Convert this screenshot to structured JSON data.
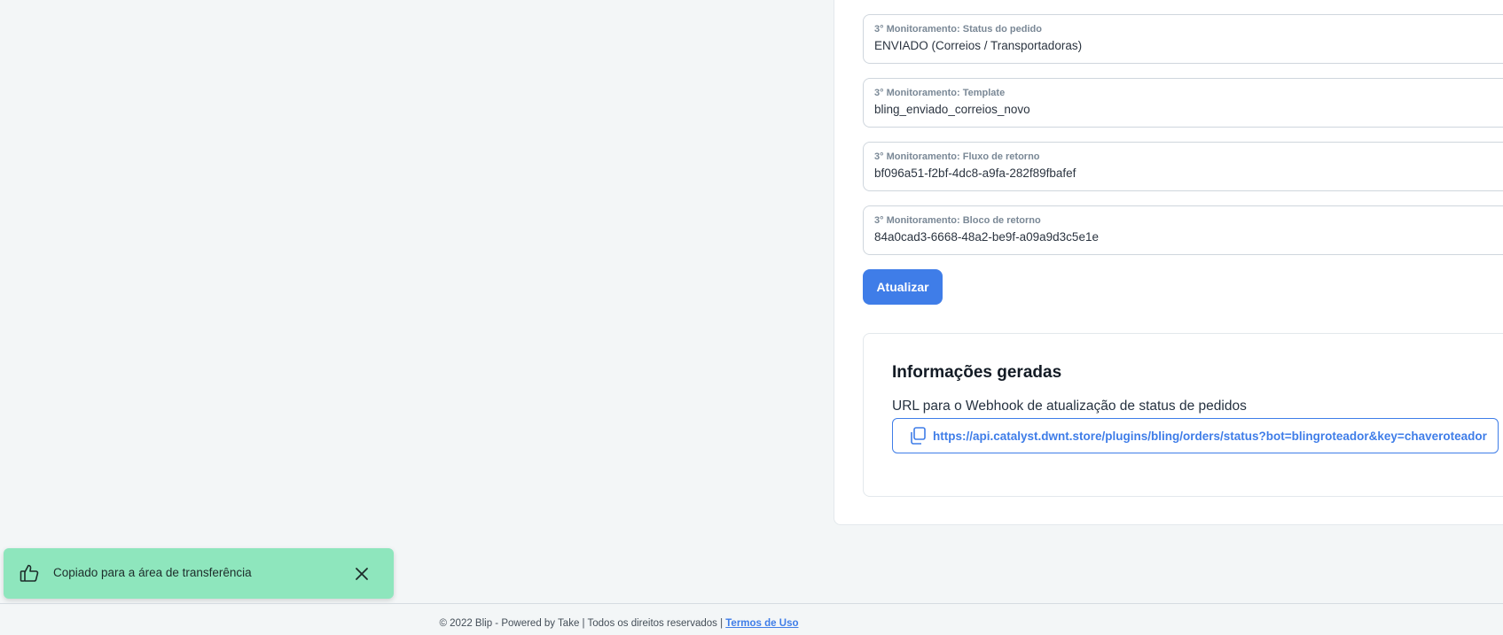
{
  "fields": [
    {
      "label": "3° Monitoramento: Status do pedido",
      "value": "ENVIADO (Correios / Transportadoras)"
    },
    {
      "label": "3° Monitoramento: Template",
      "value": "bling_enviado_correios_novo"
    },
    {
      "label": "3° Monitoramento: Fluxo de retorno",
      "value": "bf096a51-f2bf-4dc8-a9fa-282f89fbafef"
    },
    {
      "label": "3° Monitoramento: Bloco de retorno",
      "value": "84a0cad3-6668-48a2-be9f-a09a9d3c5e1e"
    }
  ],
  "update_button": {
    "label": "Atualizar"
  },
  "info": {
    "title": "Informações geradas",
    "webhook_label": "URL para o Webhook de atualização de status de pedidos",
    "webhook_url": "https://api.catalyst.dwnt.store/plugins/bling/orders/status?bot=blingroteador&key=chaveroteador",
    "copy_icon": "copy-icon"
  },
  "toast": {
    "message": "Copiado para a área de transferência",
    "icon": "thumbs-up-icon",
    "close_icon": "close-icon"
  },
  "footer": {
    "text": "© 2022 Blip - Powered by Take | Todos os direitos reservados | ",
    "link": "Termos de Uso"
  },
  "colors": {
    "page_background": "#f3f6f7",
    "accent": "#3f7de8",
    "toast_background": "#8ee6bd"
  }
}
